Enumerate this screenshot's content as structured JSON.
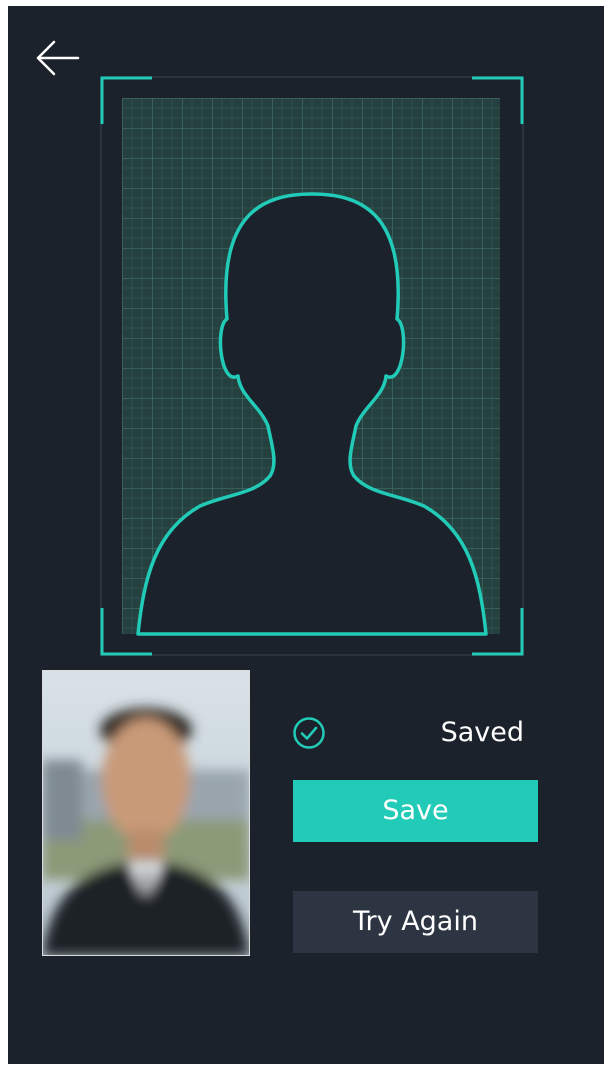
{
  "header": {
    "back_icon": "arrow-left-icon"
  },
  "capture": {
    "guide_icon": "person-silhouette-icon",
    "accent_color": "#22cbb7",
    "grid_color": "#3f6b63"
  },
  "photo": {
    "description_icon": "captured-face-photo"
  },
  "status": {
    "icon": "check-circle-icon",
    "text": "Saved"
  },
  "actions": {
    "save_label": "Save",
    "retry_label": "Try Again"
  },
  "colors": {
    "background": "#1c222b",
    "primary_button": "#22cbb7",
    "secondary_button": "#2d3542"
  }
}
